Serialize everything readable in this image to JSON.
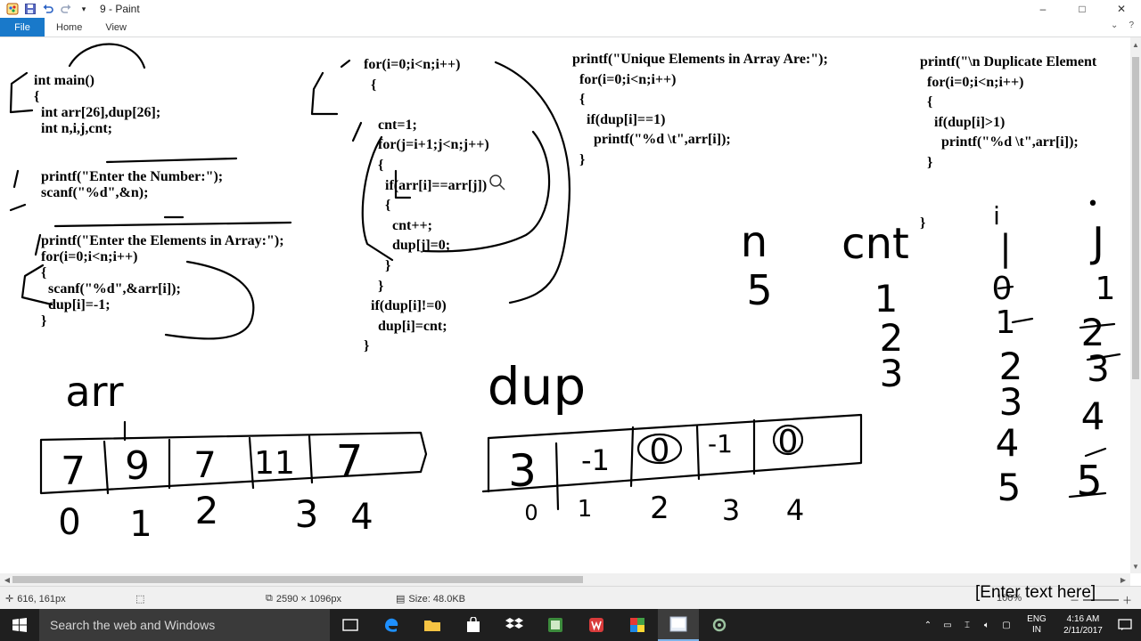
{
  "window": {
    "title": "9 - Paint",
    "controls": {
      "minimize": "–",
      "maximize": "□",
      "close": "✕"
    }
  },
  "ribbon": {
    "file_label": "File",
    "tabs": [
      "Home",
      "View"
    ]
  },
  "canvas": {
    "code_main": "int main()\n{\n  int arr[26],dup[26];\n  int n,i,j,cnt;\n\n\n  printf(\"Enter the Number:\");\n  scanf(\"%d\",&n);\n\n\n  printf(\"Enter the Elements in Array:\");\n  for(i=0;i<n;i++)\n  {\n    scanf(\"%d\",&arr[i]);\n    dup[i]=-1;\n  }",
    "code_loop": "for(i=0;i<n;i++)\n  {\n\n    cnt=1;\n    for(j=i+1;j<n;j++)\n    {\n      if(arr[i]==arr[j])\n      {\n        cnt++;\n        dup[j]=0;\n      }\n    }\n  if(dup[i]!=0)\n    dup[i]=cnt;\n}",
    "code_unique": "printf(\"Unique Elements in Array Are:\");\n  for(i=0;i<n;i++)\n  {\n    if(dup[i]==1)\n      printf(\"%d \\t\",arr[i]);\n  }",
    "code_duplicate": "printf(\"\\n Duplicate Element\n  for(i=0;i<n;i++)\n  {\n    if(dup[i]>1)\n      printf(\"%d \\t\",arr[i]);\n  }\n\n\n}",
    "handwriting": {
      "arr_label": "arr",
      "dup_label": "dup",
      "n_label": "n",
      "n_value": "5",
      "cnt_label": "cnt",
      "cnt_values": [
        "1",
        "2",
        "3"
      ],
      "i_label": "i",
      "j_label": "J",
      "i_values": [
        "0",
        "1",
        "2",
        "3",
        "4",
        "5"
      ],
      "j_values": [
        "1",
        "2",
        "3",
        "4",
        "5"
      ],
      "arr_cells": [
        "7",
        "9",
        "7",
        "11",
        "7"
      ],
      "arr_indices": [
        "0",
        "1",
        "2",
        "3",
        "4"
      ],
      "dup_cells": [
        "3",
        "-1",
        "0",
        "-1",
        "0"
      ],
      "dup_indices": [
        "0",
        "1",
        "2",
        "3",
        "4"
      ]
    },
    "text_tool_placeholder": "[Enter text here]"
  },
  "statusbar": {
    "cursor_pos": "616, 161px",
    "image_size": "2590 × 1096px",
    "file_size": "Size: 48.0KB",
    "zoom": "100%"
  },
  "taskbar": {
    "search_placeholder": "Search the web and Windows",
    "lang": "ENG",
    "region": "IN",
    "time": "4:16 AM",
    "date": "2/11/2017"
  },
  "colors": {
    "file_tab": "#1979ca",
    "taskbar": "#1f1f1f",
    "ink": "#000000"
  }
}
